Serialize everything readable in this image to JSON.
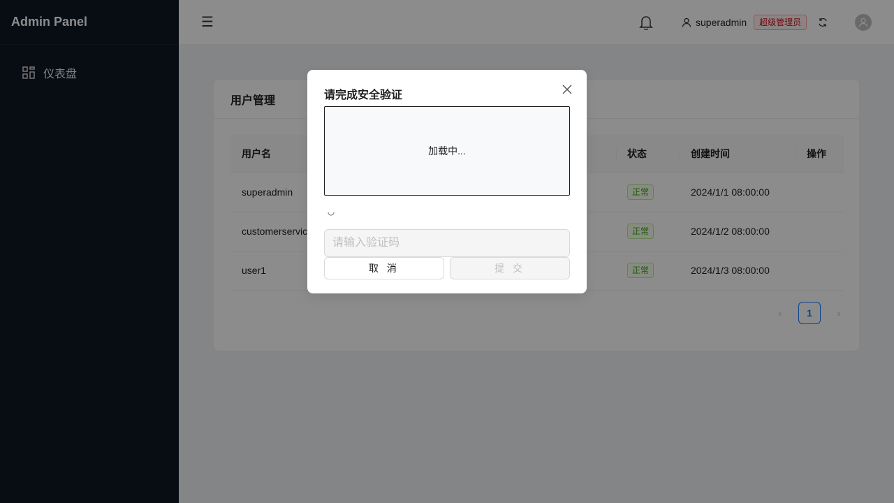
{
  "app": {
    "title": "Admin Panel"
  },
  "sidebar": {
    "items": [
      {
        "label": "仪表盘",
        "icon": "dashboard-icon"
      }
    ]
  },
  "header": {
    "username": "superadmin",
    "role_badge": "超级管理员",
    "icons": [
      "menu-icon",
      "bell-icon",
      "user-icon",
      "refresh-icon",
      "avatar-icon"
    ]
  },
  "card": {
    "title": "用户管理",
    "columns": [
      "用户名",
      "状态",
      "创建时间",
      "操作"
    ],
    "rows": [
      {
        "username": "superadmin",
        "status": "正常",
        "created": "2024/1/1 08:00:00"
      },
      {
        "username": "customerservic",
        "status": "正常",
        "created": "2024/1/2 08:00:00"
      },
      {
        "username": "user1",
        "status": "正常",
        "created": "2024/1/3 08:00:00"
      }
    ],
    "pagination": {
      "current": "1"
    }
  },
  "modal": {
    "title": "请完成安全验证",
    "loading_text": "加载中...",
    "input_placeholder": "请输入验证码",
    "cancel_label": "取 消",
    "submit_label": "提 交"
  },
  "colors": {
    "sidebar_bg": "#0f1724",
    "accent": "#1677ff",
    "role_badge": "#cf1322",
    "status_green": "#389e0d"
  }
}
